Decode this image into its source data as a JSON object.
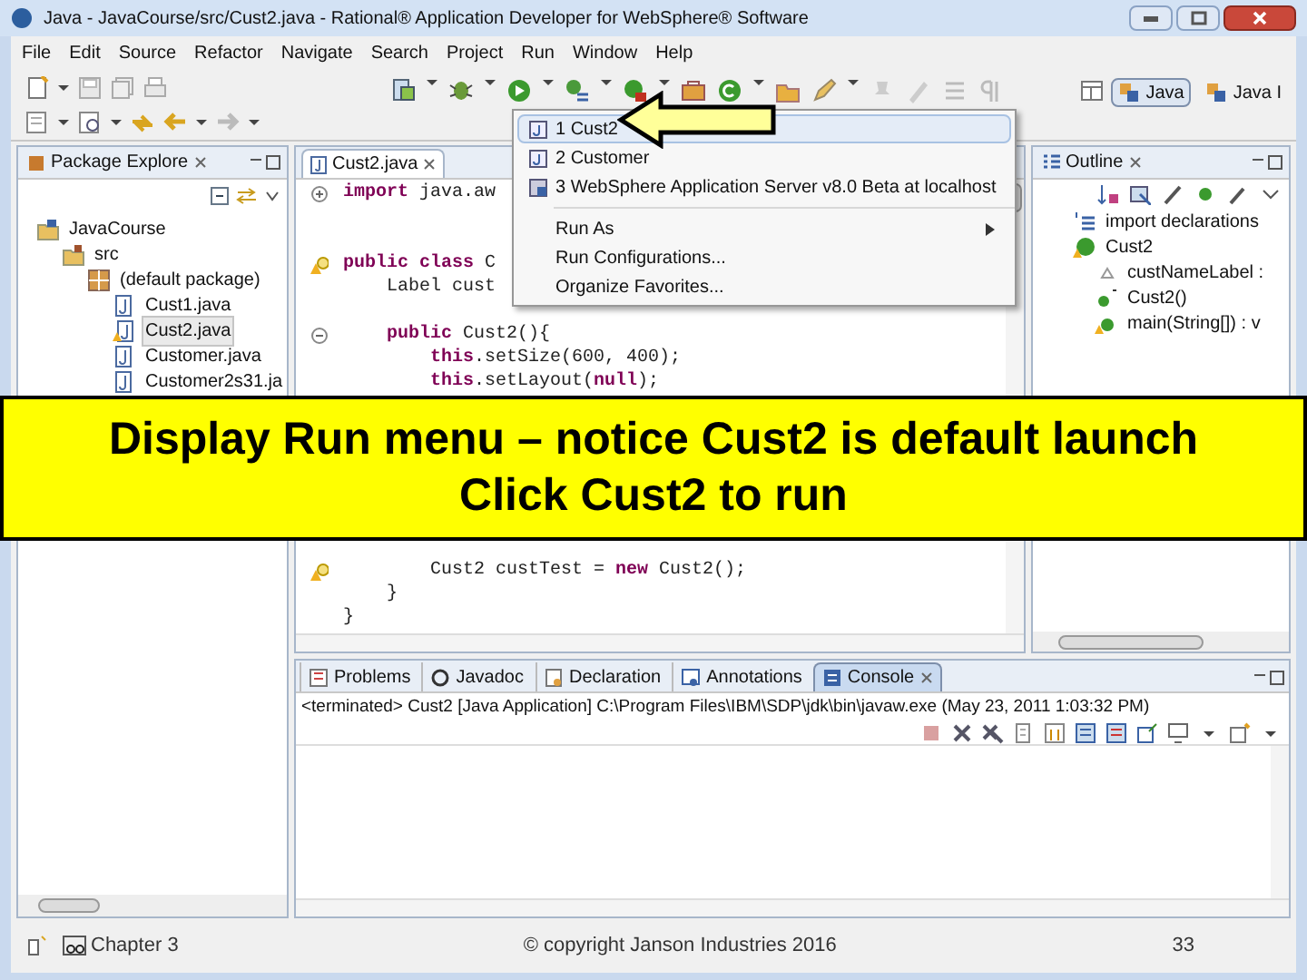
{
  "window": {
    "title": "Java - JavaCourse/src/Cust2.java - Rational® Application Developer for WebSphere® Software"
  },
  "menu_bar": [
    "File",
    "Edit",
    "Source",
    "Refactor",
    "Navigate",
    "Search",
    "Project",
    "Run",
    "Window",
    "Help"
  ],
  "perspectives": [
    {
      "label": "Java",
      "selected": true
    },
    {
      "label": "Java I",
      "selected": false
    }
  ],
  "package_explorer": {
    "title": "Package Explore",
    "tree": [
      {
        "label": "JavaCourse",
        "kind": "project",
        "selected": false,
        "children": [
          {
            "label": "src",
            "kind": "folder",
            "selected": false,
            "children": [
              {
                "label": "(default package)",
                "kind": "package",
                "selected": false,
                "children": [
                  {
                    "label": "Cust1.java",
                    "kind": "file",
                    "selected": false
                  },
                  {
                    "label": "Cust2.java",
                    "kind": "file-warning",
                    "selected": true
                  },
                  {
                    "label": "Customer.java",
                    "kind": "file",
                    "selected": false
                  },
                  {
                    "label": "Customer2s31.ja",
                    "kind": "file",
                    "selected": false
                  }
                ]
              }
            ]
          }
        ]
      }
    ]
  },
  "editor": {
    "tab": "Cust2.java",
    "lines": [
      {
        "kind": "fold-closed",
        "parts": [
          {
            "kind": "keyword",
            "text": "import"
          },
          {
            "kind": "plain",
            "text": " java.aw"
          }
        ]
      },
      {
        "kind": "blank"
      },
      {
        "kind": "blank"
      },
      {
        "kind": "warning",
        "parts": [
          {
            "kind": "keyword",
            "text": "public class"
          },
          {
            "kind": "plain",
            "text": " C"
          }
        ]
      },
      {
        "kind": "plain",
        "parts": [
          {
            "kind": "plain",
            "text": "    Label cust"
          }
        ]
      },
      {
        "kind": "blank"
      },
      {
        "kind": "fold-open",
        "parts": [
          {
            "kind": "keyword",
            "text": "    public"
          },
          {
            "kind": "plain",
            "text": " Cust2(){"
          }
        ]
      },
      {
        "kind": "plain",
        "parts": [
          {
            "kind": "keyword",
            "text": "        this"
          },
          {
            "kind": "plain",
            "text": ".setSize(600, 400);"
          }
        ]
      },
      {
        "kind": "plain",
        "parts": [
          {
            "kind": "keyword",
            "text": "        this"
          },
          {
            "kind": "plain",
            "text": ".setLayout("
          },
          {
            "kind": "keyword",
            "text": "null"
          },
          {
            "kind": "plain",
            "text": ");"
          }
        ]
      },
      {
        "kind": "blank"
      },
      {
        "kind": "blank"
      },
      {
        "kind": "blank"
      },
      {
        "kind": "blank"
      },
      {
        "kind": "blank"
      },
      {
        "kind": "blank"
      },
      {
        "kind": "blank"
      },
      {
        "kind": "warning",
        "parts": [
          {
            "kind": "plain",
            "text": "        Cust2 custTest = "
          },
          {
            "kind": "keyword",
            "text": "new"
          },
          {
            "kind": "plain",
            "text": " Cust2();"
          }
        ]
      },
      {
        "kind": "plain",
        "parts": [
          {
            "kind": "plain",
            "text": "    }"
          }
        ]
      },
      {
        "kind": "plain",
        "parts": [
          {
            "kind": "plain",
            "text": "}"
          }
        ]
      }
    ]
  },
  "outline": {
    "title": "Outline",
    "tree": [
      {
        "label": "import declarations",
        "kind": "imports"
      },
      {
        "label": "Cust2",
        "kind": "class",
        "children": [
          {
            "label": "custNameLabel :",
            "kind": "field"
          },
          {
            "label": "Cust2()",
            "kind": "constructor"
          },
          {
            "label": "main(String[]) : v",
            "kind": "method"
          }
        ]
      }
    ]
  },
  "run_menu": [
    {
      "kind": "java-launch",
      "label": "1 Cust2",
      "selected": true
    },
    {
      "kind": "java-launch",
      "label": "2 Customer",
      "selected": false
    },
    {
      "kind": "server-launch",
      "label": "3 WebSphere Application Server v8.0 Beta at localhost",
      "selected": false
    },
    {
      "kind": "separator"
    },
    {
      "kind": "command",
      "label": "Run As",
      "submenu": true,
      "selected": false
    },
    {
      "kind": "command",
      "label": "Run Configurations...",
      "submenu": false,
      "selected": false
    },
    {
      "kind": "command",
      "label": "Organize Favorites...",
      "submenu": false,
      "selected": false
    }
  ],
  "bottom_tabs": [
    {
      "label": "Problems",
      "selected": false
    },
    {
      "label": "Javadoc",
      "selected": false
    },
    {
      "label": "Declaration",
      "selected": false
    },
    {
      "label": "Annotations",
      "selected": false
    },
    {
      "label": "Console",
      "selected": true
    }
  ],
  "console": {
    "header": "<terminated> Cust2 [Java Application] C:\\Program Files\\IBM\\SDP\\jdk\\bin\\javaw.exe (May 23, 2011 1:03:32 PM)"
  },
  "banner": {
    "lines": [
      "Display Run menu – notice Cust2 is default launch",
      "Click Cust2 to run"
    ]
  },
  "footer": {
    "chapter": "Chapter 3",
    "copyright": "© copyright Janson Industries 2016",
    "page": "33"
  }
}
